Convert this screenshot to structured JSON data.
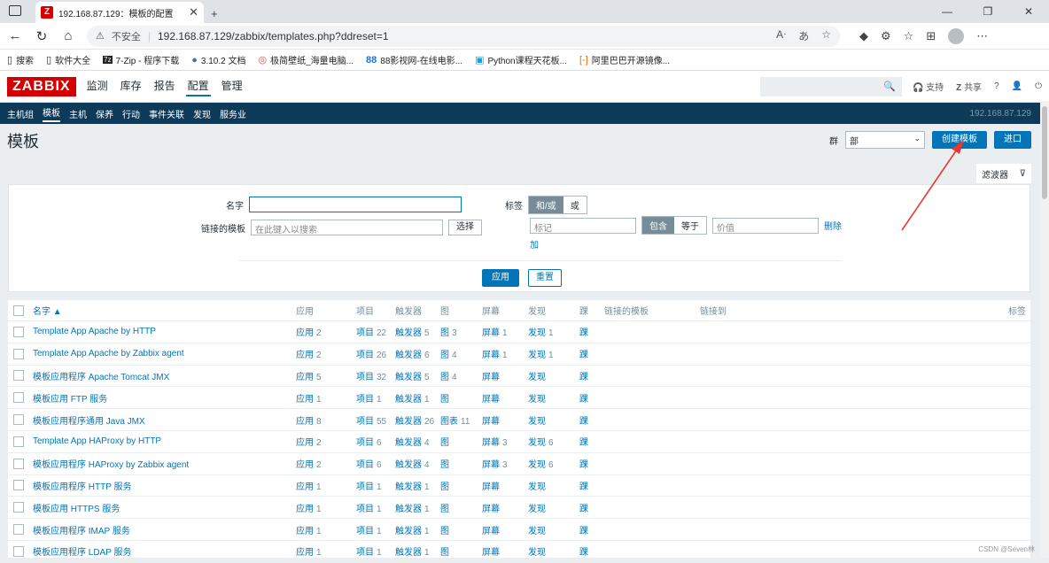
{
  "browser": {
    "tab_title": "192.168.87.129：模板的配置",
    "tab_favicon": "Z",
    "url": "192.168.87.129/zabbix/templates.php?ddreset=1",
    "security": "不安全",
    "bookmarks": [
      "搜索",
      "软件大全",
      "7-Zip - 程序下载",
      "3.10.2 文档",
      "极简壁纸_海量电脑...",
      "88影视网-在线电影...",
      "Python课程天花板...",
      "阿里巴巴开源镜像..."
    ]
  },
  "zabbix": {
    "logo": "ZABBIX",
    "menu": [
      "监测",
      "库存",
      "报告",
      "配置",
      "管理"
    ],
    "active_menu": "配置",
    "support": "支持",
    "share": "共享",
    "help": "?",
    "submenu": [
      "主机组",
      "模板",
      "主机",
      "保养",
      "行动",
      "事件关联",
      "发现",
      "服务业"
    ],
    "active_sub": "模板",
    "host": "192.168.87.129"
  },
  "page": {
    "title": "模板",
    "group_label": "群",
    "group_value": "部",
    "create_btn": "创建模板",
    "import_btn": "进口",
    "filter_tab": "滤波器"
  },
  "filter": {
    "name_label": "名字",
    "linked_label": "链接的模板",
    "linked_placeholder": "在此键入以搜索",
    "select_btn": "选择",
    "tags_label": "标签",
    "andor": "和/或",
    "or": "或",
    "tag_placeholder": "标记",
    "contains": "包含",
    "equals": "等于",
    "value_placeholder": "价值",
    "remove": "删除",
    "add": "加",
    "apply": "应用",
    "reset": "重置"
  },
  "table": {
    "headers": [
      "名字 ▲",
      "应用",
      "项目",
      "触发器",
      "图",
      "屏幕",
      "发现",
      "踝",
      "链接的模板",
      "链接到",
      "标签"
    ],
    "rows": [
      {
        "name": "Template App Apache by HTTP",
        "app": "应用",
        "app_n": "2",
        "items": "项目",
        "items_n": "22",
        "trig": "触发器",
        "trig_n": "5",
        "graph": "图",
        "graph_n": "3",
        "screen": "屏幕",
        "screen_n": "1",
        "disc": "发现",
        "disc_n": "1",
        "web": "踝"
      },
      {
        "name": "Template App Apache by Zabbix agent",
        "app": "应用",
        "app_n": "2",
        "items": "项目",
        "items_n": "26",
        "trig": "触发器",
        "trig_n": "6",
        "graph": "图",
        "graph_n": "4",
        "screen": "屏幕",
        "screen_n": "1",
        "disc": "发现",
        "disc_n": "1",
        "web": "踝"
      },
      {
        "name": "模板应用程序 Apache Tomcat JMX",
        "app": "应用",
        "app_n": "5",
        "items": "项目",
        "items_n": "32",
        "trig": "触发器",
        "trig_n": "5",
        "graph": "图",
        "graph_n": "4",
        "screen": "屏幕",
        "screen_n": "",
        "disc": "发现",
        "disc_n": "",
        "web": "踝"
      },
      {
        "name": "模板应用 FTP 服务",
        "app": "应用",
        "app_n": "1",
        "items": "项目",
        "items_n": "1",
        "trig": "触发器",
        "trig_n": "1",
        "graph": "图",
        "graph_n": "",
        "screen": "屏幕",
        "screen_n": "",
        "disc": "发现",
        "disc_n": "",
        "web": "踝"
      },
      {
        "name": "模板应用程序通用 Java JMX",
        "app": "应用",
        "app_n": "8",
        "items": "项目",
        "items_n": "55",
        "trig": "触发器",
        "trig_n": "26",
        "graph": "图表",
        "graph_n": "11",
        "screen": "屏幕",
        "screen_n": "",
        "disc": "发现",
        "disc_n": "",
        "web": "踝"
      },
      {
        "name": "Template App HAProxy by HTTP",
        "app": "应用",
        "app_n": "2",
        "items": "项目",
        "items_n": "6",
        "trig": "触发器",
        "trig_n": "4",
        "graph": "图",
        "graph_n": "",
        "screen": "屏幕",
        "screen_n": "3",
        "disc": "发现",
        "disc_n": "6",
        "web": "踝"
      },
      {
        "name": "模板应用程序 HAProxy by Zabbix agent",
        "app": "应用",
        "app_n": "2",
        "items": "项目",
        "items_n": "6",
        "trig": "触发器",
        "trig_n": "4",
        "graph": "图",
        "graph_n": "",
        "screen": "屏幕",
        "screen_n": "3",
        "disc": "发现",
        "disc_n": "6",
        "web": "踝"
      },
      {
        "name": "模板应用程序 HTTP 服务",
        "app": "应用",
        "app_n": "1",
        "items": "项目",
        "items_n": "1",
        "trig": "触发器",
        "trig_n": "1",
        "graph": "图",
        "graph_n": "",
        "screen": "屏幕",
        "screen_n": "",
        "disc": "发现",
        "disc_n": "",
        "web": "踝"
      },
      {
        "name": "模板应用 HTTPS 服务",
        "app": "应用",
        "app_n": "1",
        "items": "项目",
        "items_n": "1",
        "trig": "触发器",
        "trig_n": "1",
        "graph": "图",
        "graph_n": "",
        "screen": "屏幕",
        "screen_n": "",
        "disc": "发现",
        "disc_n": "",
        "web": "踝"
      },
      {
        "name": "模板应用程序 IMAP 服务",
        "app": "应用",
        "app_n": "1",
        "items": "项目",
        "items_n": "1",
        "trig": "触发器",
        "trig_n": "1",
        "graph": "图",
        "graph_n": "",
        "screen": "屏幕",
        "screen_n": "",
        "disc": "发现",
        "disc_n": "",
        "web": "踝"
      },
      {
        "name": "模板应用程序 LDAP 服务",
        "app": "应用",
        "app_n": "1",
        "items": "项目",
        "items_n": "1",
        "trig": "触发器",
        "trig_n": "1",
        "graph": "图",
        "graph_n": "",
        "screen": "屏幕",
        "screen_n": "",
        "disc": "发现",
        "disc_n": "",
        "web": "踝"
      }
    ]
  },
  "watermark": "CSDN @Seven林",
  "colors": {
    "brand": "#d40000",
    "link": "#0275b8",
    "nav": "#0e3a5a",
    "arrow": "#e53935"
  }
}
